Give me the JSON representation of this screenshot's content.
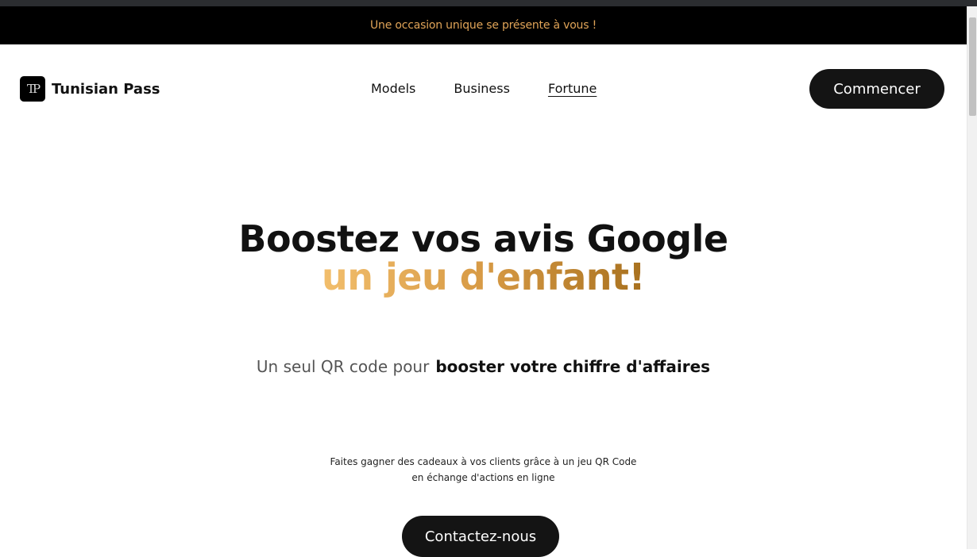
{
  "announcement": "Une occasion unique se présente à vous !",
  "brand": {
    "logo_text": "TP",
    "name": "Tunisian Pass"
  },
  "nav": {
    "items": [
      "Models",
      "Business",
      "Fortune"
    ],
    "active": "Fortune"
  },
  "header_cta": "Commencer",
  "hero": {
    "title": "Boostez vos avis Google",
    "accent": "un jeu d'enfant!",
    "sub_light": "Un seul QR code pour",
    "sub_bold": "booster votre chiffre d'affaires",
    "desc_line1": "Faites gagner des cadeaux à vos clients grâce à un jeu QR Code",
    "desc_line2": "en échange d'actions en ligne",
    "contact_label": "Contactez-nous"
  },
  "colors": {
    "announce_text": "#e0a458",
    "accent_gradient_start": "#f2be6c",
    "accent_gradient_end": "#a8711f",
    "button_bg": "#141414"
  }
}
